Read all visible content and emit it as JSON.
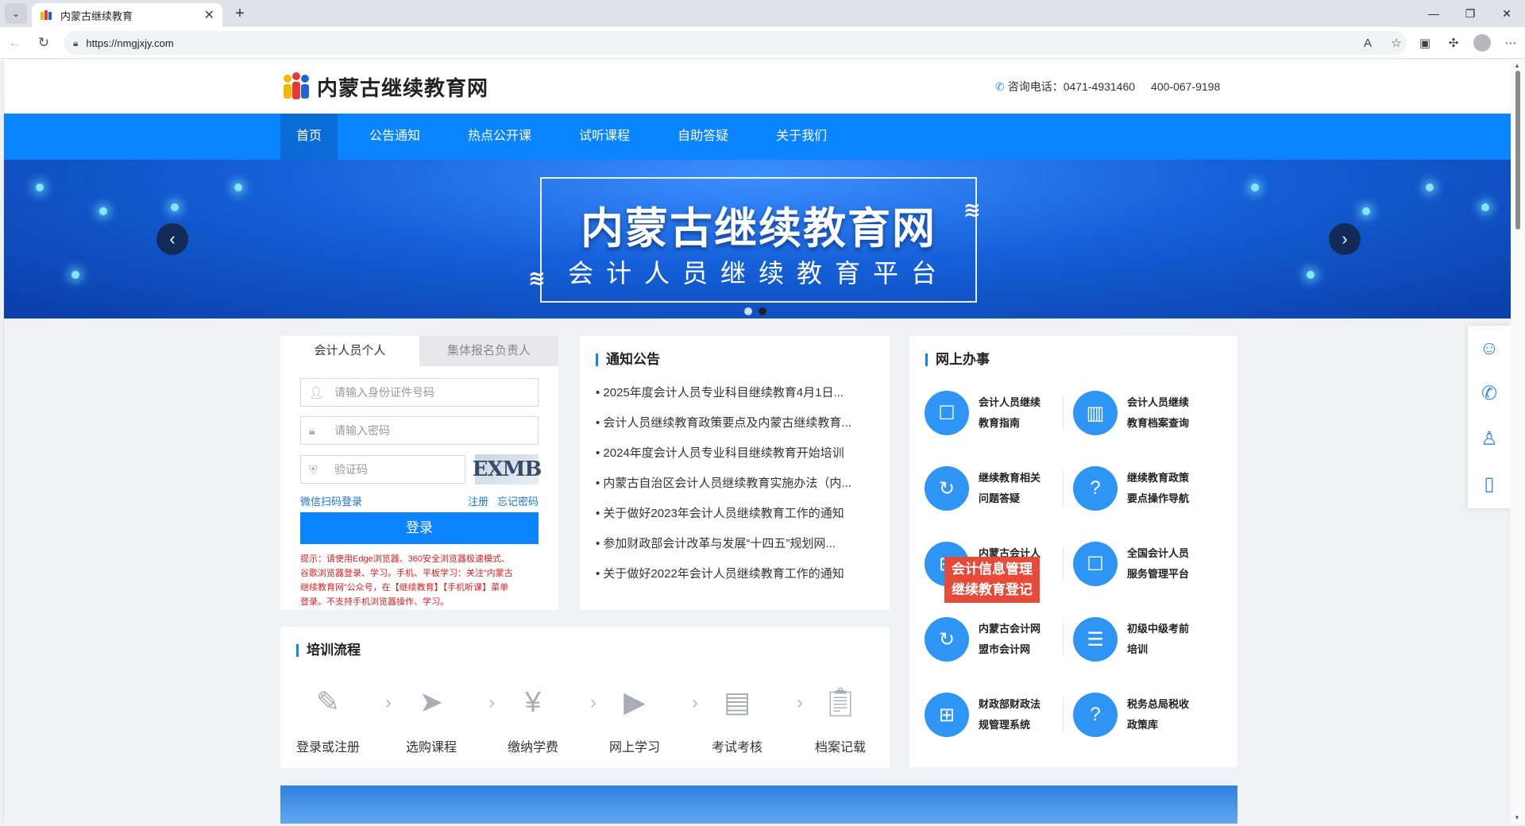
{
  "browser": {
    "tab_title": "内蒙古继续教育",
    "url": "https://nmgjxjy.com",
    "icons": [
      "tab-list-icon",
      "favicon",
      "close-icon",
      "new-tab-icon",
      "minimize-icon",
      "restore-icon",
      "close-window-icon",
      "back-icon",
      "refresh-icon",
      "lock-icon",
      "read-aloud-icon",
      "favorite-icon",
      "collections-icon",
      "extensions-icon",
      "profile-icon",
      "more-icon"
    ]
  },
  "header": {
    "site_name": "内蒙古继续教育网",
    "hotline_label": "咨询电话：",
    "phone1": "0471-4931460",
    "phone2": "400-067-9198"
  },
  "nav": {
    "items": [
      "首页",
      "公告通知",
      "热点公开课",
      "试听课程",
      "自助答疑",
      "关于我们"
    ],
    "active": "首页"
  },
  "banner": {
    "title": "内蒙古继续教育网",
    "subtitle": "会计人员继续教育平台",
    "wave_glyph": "≋"
  },
  "login": {
    "tab_individual": "会计人员个人",
    "tab_group": "集体报名负责人",
    "id_placeholder": "请输入身份证件号码",
    "password_placeholder": "请输入密码",
    "captcha_placeholder": "验证码",
    "captcha_text": "EXMB",
    "wechat_login": "微信扫码登录",
    "register": "注册",
    "forgot": "忘记密码",
    "login_button": "登录",
    "tip_line1": "提示：请使用Edge浏览器、360安全浏览器极速模式、",
    "tip_line2": "谷歌浏览器登录、学习。手机、平板学习：关注“内蒙古",
    "tip_line3": "继续教育网”公众号，在【继续教育】【手机听课】菜单",
    "tip_line4": "登录。不支持手机浏览器操作、学习。"
  },
  "notice": {
    "title": "通知公告",
    "items": [
      "2025年度会计人员专业科目继续教育4月1日...",
      "会计人员继续教育政策要点及内蒙古继续教育...",
      "2024年度会计人员专业科目继续教育开始培训",
      "内蒙古自治区会计人员继续教育实施办法（内...",
      "关于做好2023年会计人员继续教育工作的通知",
      "参加财政部会计改革与发展“十四五”规划网...",
      "关于做好2022年会计人员继续教育工作的通知"
    ]
  },
  "online": {
    "title": "网上办事",
    "services": [
      {
        "l1": "会计人员继续",
        "l2": "教育指南",
        "icon": "chat-icon"
      },
      {
        "l1": "会计人员继续",
        "l2": "教育档案查询",
        "icon": "archive-icon"
      },
      {
        "l1": "继续教育相关",
        "l2": "问题答疑",
        "icon": "refresh-circle-icon"
      },
      {
        "l1": "继续教育政策",
        "l2": "要点操作导航",
        "icon": "question-icon"
      },
      {
        "l1": "内蒙古会计人",
        "l2": "员信息采集",
        "icon": "grid-icon"
      },
      {
        "l1": "全国会计人员",
        "l2": "服务管理平台",
        "icon": "chat-icon"
      },
      {
        "l1": "内蒙古会计网",
        "l2": "盟市会计网",
        "icon": "refresh-circle-icon"
      },
      {
        "l1": "初级中级考前",
        "l2": "培训",
        "icon": "list-icon"
      },
      {
        "l1": "财政部财政法",
        "l2": "规管理系统",
        "icon": "grid-icon"
      },
      {
        "l1": "税务总局税收",
        "l2": "政策库",
        "icon": "question-icon"
      }
    ],
    "promo_l1": "会计信息管理",
    "promo_l2": "继续教育登记"
  },
  "training": {
    "title": "培训流程",
    "steps": [
      "登录或注册",
      "选购课程",
      "缴纳学费",
      "网上学习",
      "考试考核",
      "档案记载"
    ]
  },
  "colors": {
    "primary": "#0a84ff",
    "nav_active": "#0a6bd6",
    "service_icon": "#2f95f5",
    "tip": "#e02020",
    "promo": "#e84a3a"
  }
}
